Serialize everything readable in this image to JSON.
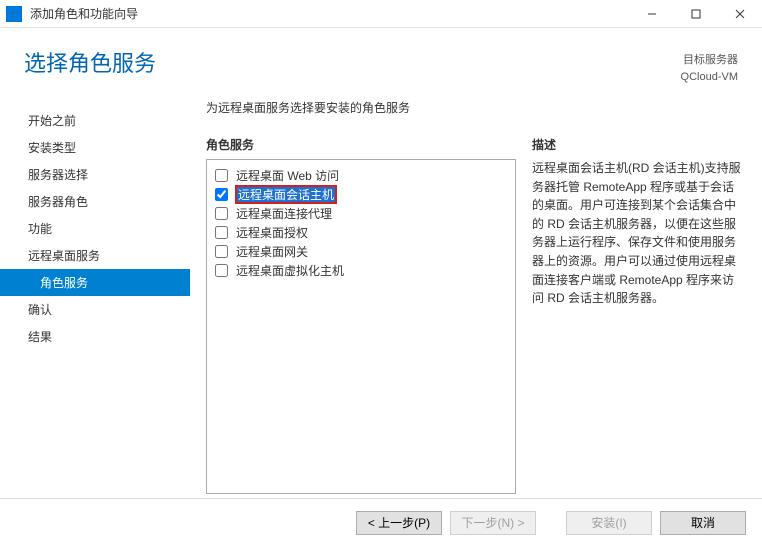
{
  "titlebar": {
    "title": "添加角色和功能向导"
  },
  "header": {
    "heading": "选择角色服务",
    "target_label": "目标服务器",
    "target_value": "QCloud-VM"
  },
  "sidebar": {
    "items": [
      {
        "label": "开始之前",
        "selected": false,
        "indent": false
      },
      {
        "label": "安装类型",
        "selected": false,
        "indent": false
      },
      {
        "label": "服务器选择",
        "selected": false,
        "indent": false
      },
      {
        "label": "服务器角色",
        "selected": false,
        "indent": false
      },
      {
        "label": "功能",
        "selected": false,
        "indent": false
      },
      {
        "label": "远程桌面服务",
        "selected": false,
        "indent": false
      },
      {
        "label": "角色服务",
        "selected": true,
        "indent": true
      },
      {
        "label": "确认",
        "selected": false,
        "indent": false
      },
      {
        "label": "结果",
        "selected": false,
        "indent": false
      }
    ]
  },
  "main": {
    "instruction": "为远程桌面服务选择要安装的角色服务",
    "roles_title": "角色服务",
    "desc_title": "描述",
    "roles": [
      {
        "label": "远程桌面 Web 访问",
        "checked": false,
        "highlight": false
      },
      {
        "label": "远程桌面会话主机",
        "checked": true,
        "highlight": true
      },
      {
        "label": "远程桌面连接代理",
        "checked": false,
        "highlight": false
      },
      {
        "label": "远程桌面授权",
        "checked": false,
        "highlight": false
      },
      {
        "label": "远程桌面网关",
        "checked": false,
        "highlight": false
      },
      {
        "label": "远程桌面虚拟化主机",
        "checked": false,
        "highlight": false
      }
    ],
    "description": "远程桌面会话主机(RD 会话主机)支持服务器托管 RemoteApp 程序或基于会话的桌面。用户可连接到某个会话集合中的 RD 会话主机服务器，以便在这些服务器上运行程序、保存文件和使用服务器上的资源。用户可以通过使用远程桌面连接客户端或 RemoteApp 程序来访问 RD 会话主机服务器。"
  },
  "footer": {
    "prev": "< 上一步(P)",
    "next": "下一步(N) >",
    "install": "安装(I)",
    "cancel": "取消"
  }
}
